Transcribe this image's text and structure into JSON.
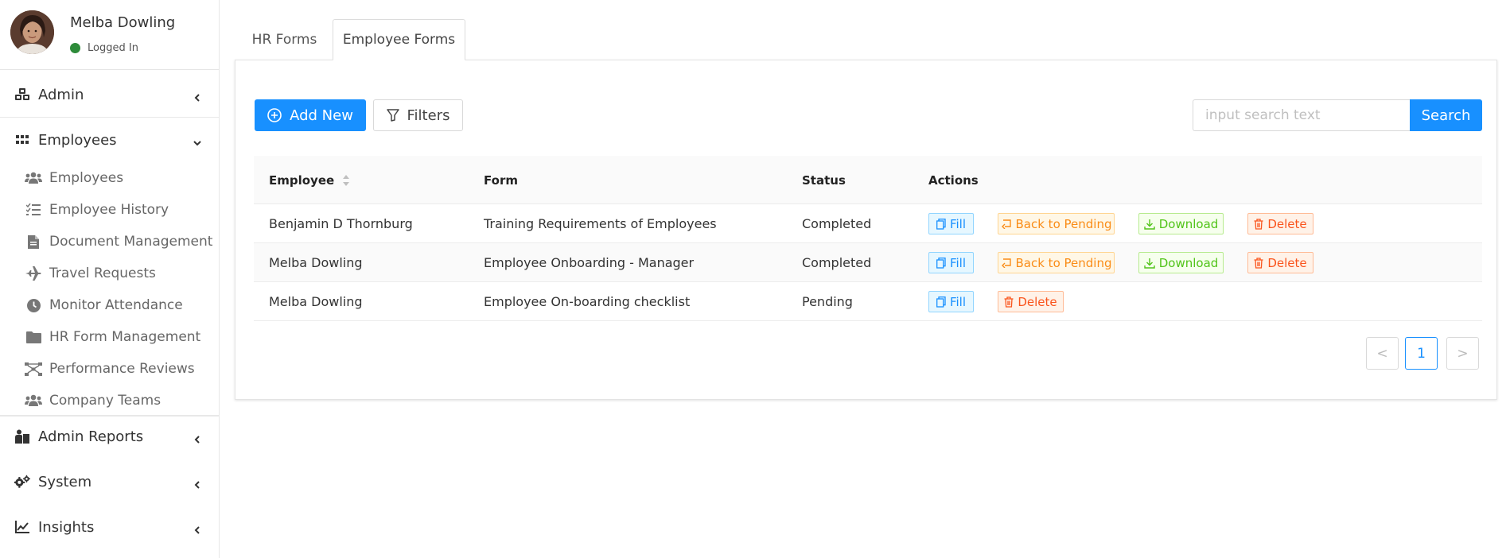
{
  "user": {
    "name": "Melba Dowling",
    "status": "Logged In",
    "status_color": "#2e8b3a"
  },
  "sidebar": {
    "menu": [
      {
        "key": "admin",
        "label": "Admin",
        "icon": "cubes-icon"
      },
      {
        "key": "employees",
        "label": "Employees",
        "icon": "grid-icon"
      },
      {
        "key": "admin-reports",
        "label": "Admin Reports",
        "icon": "reports-icon"
      },
      {
        "key": "system",
        "label": "System",
        "icon": "gears-icon"
      },
      {
        "key": "insights",
        "label": "Insights",
        "icon": "line-chart-icon"
      }
    ],
    "employees_sub": [
      {
        "label": "Employees",
        "icon": "users-icon"
      },
      {
        "label": "Employee History",
        "icon": "list-check-icon"
      },
      {
        "label": "Document Management",
        "icon": "file-icon"
      },
      {
        "label": "Travel Requests",
        "icon": "plane-icon"
      },
      {
        "label": "Monitor Attendance",
        "icon": "clock-icon"
      },
      {
        "label": "HR Form Management",
        "icon": "folder-icon"
      },
      {
        "label": "Performance Reviews",
        "icon": "network-icon"
      },
      {
        "label": "Company Teams",
        "icon": "team-icon"
      }
    ]
  },
  "tabs": [
    {
      "label": "HR Forms",
      "active": false
    },
    {
      "label": "Employee Forms",
      "active": true
    }
  ],
  "toolbar": {
    "add_label": "Add New",
    "filters_label": "Filters",
    "search_placeholder": "input search text",
    "search_label": "Search"
  },
  "table": {
    "headers": {
      "employee": "Employee",
      "form": "Form",
      "status": "Status",
      "actions": "Actions"
    },
    "rows": [
      {
        "employee": "Benjamin D Thornburg",
        "form": "Training Requirements of Employees",
        "status": "Completed"
      },
      {
        "employee": "Melba Dowling",
        "form": "Employee Onboarding - Manager",
        "status": "Completed"
      },
      {
        "employee": "Melba Dowling",
        "form": "Employee On-boarding checklist",
        "status": "Pending"
      }
    ],
    "actions": {
      "fill": "Fill",
      "back_to_pending": "Back to Pending",
      "download": "Download",
      "delete": "Delete"
    }
  },
  "pagination": {
    "prev": "<",
    "current": "1",
    "next": ">"
  },
  "colors": {
    "primary": "#1890ff",
    "fill": "#1890ff",
    "pending": "#fa8c16",
    "download": "#52c41a",
    "delete": "#fa541c"
  }
}
